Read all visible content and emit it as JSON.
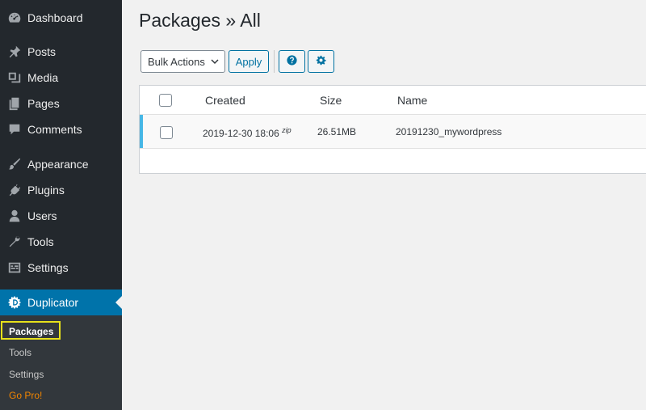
{
  "sidebar": {
    "items": [
      {
        "label": "Dashboard",
        "icon": "dashboard-icon"
      },
      {
        "label": "Posts",
        "icon": "pin-icon"
      },
      {
        "label": "Media",
        "icon": "media-icon"
      },
      {
        "label": "Pages",
        "icon": "pages-icon"
      },
      {
        "label": "Comments",
        "icon": "comment-icon"
      },
      {
        "label": "Appearance",
        "icon": "brush-icon"
      },
      {
        "label": "Plugins",
        "icon": "plug-icon"
      },
      {
        "label": "Users",
        "icon": "user-icon"
      },
      {
        "label": "Tools",
        "icon": "wrench-icon"
      },
      {
        "label": "Settings",
        "icon": "settings-icon"
      },
      {
        "label": "Duplicator",
        "icon": "duplicator-icon"
      }
    ],
    "submenu": [
      "Packages",
      "Tools",
      "Settings",
      "Go Pro!"
    ]
  },
  "main": {
    "title": "Packages » All",
    "toolbar": {
      "bulk_actions": "Bulk Actions",
      "apply": "Apply"
    },
    "table": {
      "headers": {
        "created": "Created",
        "size": "Size",
        "name": "Name"
      },
      "rows": [
        {
          "created": "2019-12-30 18:06",
          "type": "zip",
          "size": "26.51MB",
          "name": "20191230_mywordpress"
        }
      ]
    }
  },
  "colors": {
    "sidebar_bg": "#23282d",
    "active_bg": "#0073aa",
    "submenu_bg": "#32373c",
    "gopro": "#f18500",
    "highlight": "#e7e11a",
    "row_accent": "#46b7e6"
  }
}
